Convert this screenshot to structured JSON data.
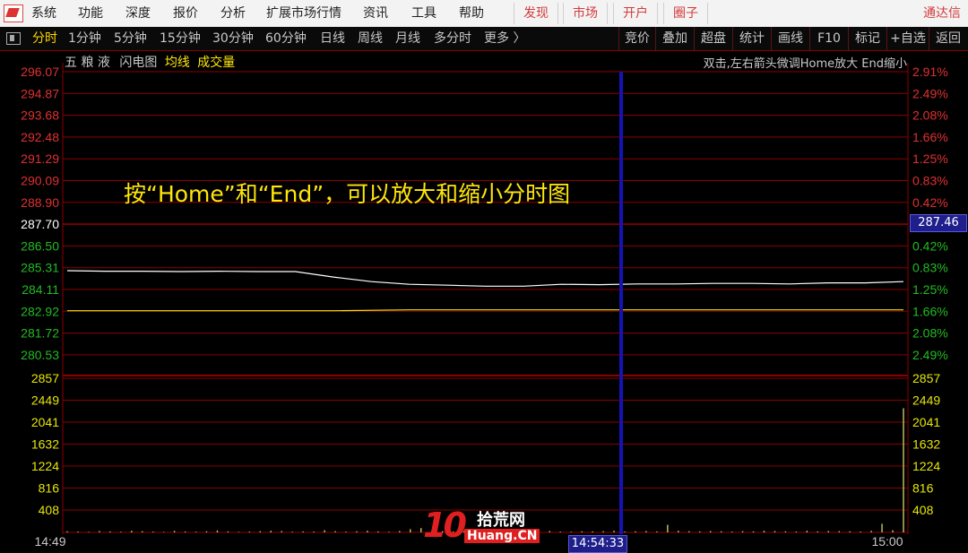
{
  "menu": {
    "items": [
      "系统",
      "功能",
      "深度",
      "报价",
      "分析",
      "扩展市场行情",
      "资讯",
      "工具",
      "帮助"
    ],
    "red_items": [
      "发现",
      "市场",
      "开户",
      "圈子"
    ],
    "brand": "通达信"
  },
  "tabs": {
    "items": [
      "分时",
      "1分钟",
      "5分钟",
      "15分钟",
      "30分钟",
      "60分钟",
      "日线",
      "周线",
      "月线",
      "多分时",
      "更多 〉"
    ],
    "active": "分时",
    "right_buttons": [
      "竞价",
      "叠加",
      "超盘",
      "统计",
      "画线",
      "F10",
      "标记",
      "+自选",
      "返回"
    ]
  },
  "info": {
    "stock_name": "五 粮 液",
    "chart_mode": "闪电图",
    "avg_line_label": "均线",
    "volume_label": "成交量",
    "hint": "双击,左右箭头微调Home放大 End缩小"
  },
  "caption": "按“Home”和“End”，可以放大和缩小分时图",
  "cursor": {
    "time": "14:54:33",
    "price": "287.46"
  },
  "colors": {
    "up": "#e03030",
    "down": "#22bb22",
    "grid": "#8b0000",
    "cursor": "#1414b4",
    "price_line": "#ffffff",
    "avg_line": "#e6e60a",
    "volume": "#c8c864"
  },
  "chart_data": {
    "type": "line",
    "price_axis": {
      "left_labels": [
        "296.07",
        "294.87",
        "293.68",
        "292.48",
        "291.29",
        "290.09",
        "288.90",
        "287.70",
        "286.50",
        "285.31",
        "284.11",
        "282.92",
        "281.72",
        "280.53"
      ],
      "right_labels": [
        "2.91%",
        "2.49%",
        "2.08%",
        "1.66%",
        "1.25%",
        "0.83%",
        "0.42%",
        "",
        "0.42%",
        "0.83%",
        "1.25%",
        "1.66%",
        "2.08%",
        "2.49%"
      ],
      "ylim": [
        280.53,
        296.07
      ],
      "prev_close": 287.7
    },
    "volume_axis": {
      "labels": [
        "2857",
        "2449",
        "2041",
        "1632",
        "1224",
        "816",
        "408"
      ],
      "ylim": [
        0,
        2857
      ]
    },
    "x_axis": {
      "start_label": "14:49",
      "end_label": "15:00",
      "minutes": 11
    },
    "series": [
      {
        "x": [
          0,
          0.5,
          1,
          1.5,
          2,
          2.5,
          3,
          3.5,
          4,
          4.5,
          5,
          5.5,
          6,
          6.5,
          7,
          7.5,
          8,
          8.5,
          9,
          9.5,
          10,
          10.5,
          11
        ],
        "values": [
          285.15,
          285.12,
          285.12,
          285.1,
          285.12,
          285.1,
          285.1,
          284.8,
          284.55,
          284.4,
          284.35,
          284.3,
          284.3,
          284.4,
          284.38,
          284.42,
          284.42,
          284.45,
          284.45,
          284.42,
          284.48,
          284.48,
          284.55
        ]
      },
      {
        "x": [
          0,
          3.5,
          4.5,
          11
        ],
        "values": [
          282.95,
          282.95,
          283.0,
          283.0
        ]
      }
    ],
    "volume": [
      20,
      15,
      10,
      25,
      18,
      12,
      30,
      22,
      14,
      10,
      28,
      16,
      12,
      20,
      35,
      18,
      10,
      14,
      22,
      30,
      25,
      12,
      18,
      15,
      40,
      22,
      14,
      20,
      30,
      18,
      12,
      25,
      60,
      80,
      30,
      22,
      18,
      25,
      14,
      20,
      30,
      15,
      22,
      18,
      30,
      25,
      14,
      12,
      20,
      18,
      22,
      30,
      15,
      20,
      25,
      18,
      140,
      30,
      22,
      18,
      25,
      20,
      14,
      22,
      18,
      30,
      25,
      20,
      15,
      30,
      18,
      25,
      22,
      20,
      15,
      28,
      160,
      40,
      2300
    ]
  }
}
